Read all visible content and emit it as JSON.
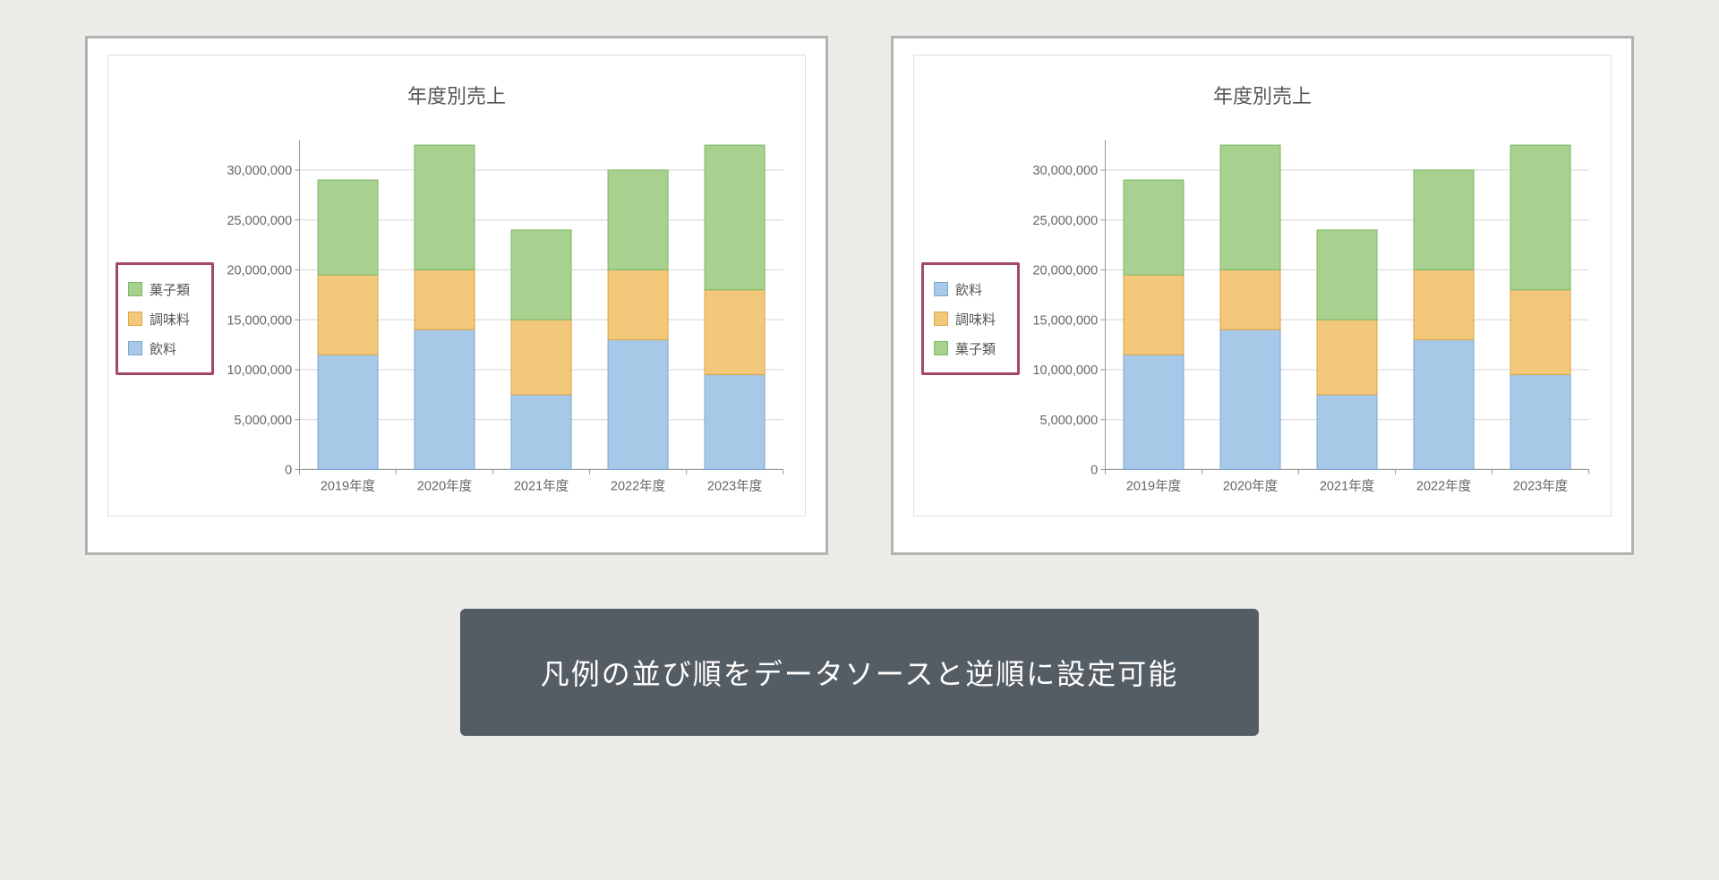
{
  "caption": "凡例の並び順をデータソースと逆順に設定可能",
  "series_labels": {
    "drinks": "飲料",
    "seasoning": "調味料",
    "sweets": "菓子類"
  },
  "chart_data": [
    {
      "type": "bar",
      "subtype": "stacked",
      "title": "年度別売上",
      "categories": [
        "2019年度",
        "2020年度",
        "2021年度",
        "2022年度",
        "2023年度"
      ],
      "series": [
        {
          "name": "飲料",
          "key": "drinks",
          "values": [
            11500000,
            14000000,
            7500000,
            13000000,
            9500000
          ]
        },
        {
          "name": "調味料",
          "key": "seasoning",
          "values": [
            8000000,
            6000000,
            7500000,
            7000000,
            8500000
          ]
        },
        {
          "name": "菓子類",
          "key": "sweets",
          "values": [
            9500000,
            12500000,
            9000000,
            10000000,
            14500000
          ]
        }
      ],
      "legend_order": [
        "sweets",
        "seasoning",
        "drinks"
      ],
      "xlabel": "",
      "ylabel": "",
      "ylim": [
        0,
        33000000
      ],
      "y_ticks": [
        0,
        5000000,
        10000000,
        15000000,
        20000000,
        25000000,
        30000000
      ],
      "y_tick_labels": [
        "0",
        "5,000,000",
        "10,000,000",
        "15,000,000",
        "20,000,000",
        "25,000,000",
        "30,000,000"
      ]
    },
    {
      "type": "bar",
      "subtype": "stacked",
      "title": "年度別売上",
      "categories": [
        "2019年度",
        "2020年度",
        "2021年度",
        "2022年度",
        "2023年度"
      ],
      "series": [
        {
          "name": "飲料",
          "key": "drinks",
          "values": [
            11500000,
            14000000,
            7500000,
            13000000,
            9500000
          ]
        },
        {
          "name": "調味料",
          "key": "seasoning",
          "values": [
            8000000,
            6000000,
            7500000,
            7000000,
            8500000
          ]
        },
        {
          "name": "菓子類",
          "key": "sweets",
          "values": [
            9500000,
            12500000,
            9000000,
            10000000,
            14500000
          ]
        }
      ],
      "legend_order": [
        "drinks",
        "seasoning",
        "sweets"
      ],
      "xlabel": "",
      "ylabel": "",
      "ylim": [
        0,
        33000000
      ],
      "y_ticks": [
        0,
        5000000,
        10000000,
        15000000,
        20000000,
        25000000,
        30000000
      ],
      "y_tick_labels": [
        "0",
        "5,000,000",
        "10,000,000",
        "15,000,000",
        "20,000,000",
        "25,000,000",
        "30,000,000"
      ]
    }
  ]
}
